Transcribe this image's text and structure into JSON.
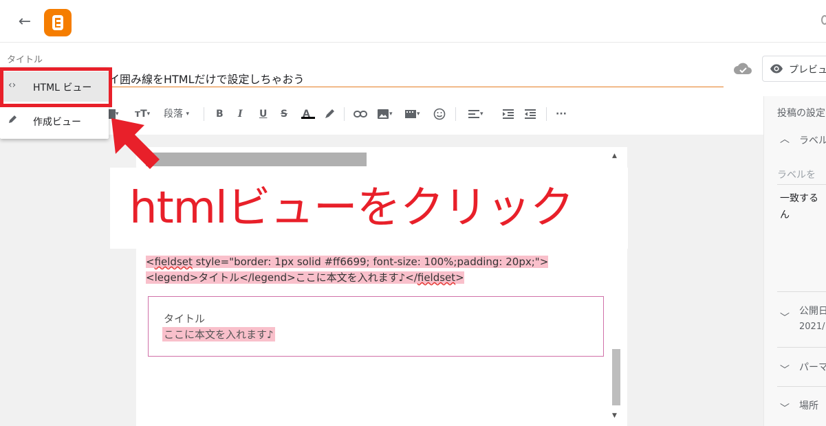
{
  "header": {
    "back_icon": "arrow-left-icon",
    "logo_icon": "blogger-logo-icon"
  },
  "title": {
    "label": "タイトル",
    "value": "イ囲み線をHTMLだけで設定しちゃおう"
  },
  "actions": {
    "preview_label": "プレビュー"
  },
  "view_menu": {
    "items": [
      {
        "icon": "code-icon",
        "label": "HTML ビュー",
        "active": true
      },
      {
        "icon": "pencil-icon",
        "label": "作成ビュー",
        "active": false
      }
    ]
  },
  "toolbar": {
    "paragraph_label": "段落",
    "bold": "B",
    "italic": "I",
    "underline": "U",
    "strike": "S",
    "font_color": "A",
    "more": "···"
  },
  "editor": {
    "code_line1_pre": "<",
    "code_line1_tag": "fieldset",
    "code_line1_post": " style=\"border: 1px solid #ff6699; font-size: 100%;padding: 20px;\">",
    "code_line2_pre": "<legend>タイトル</legend>ここに本文を入れます♪</",
    "code_line2_tag": "fieldset",
    "code_line2_post": ">",
    "fieldset_legend": "タイトル",
    "fieldset_body": "ここに本文を入れます♪"
  },
  "annotation": {
    "text": "htmlビューをクリック",
    "color": "#e8202a"
  },
  "side_panel": {
    "title": "投稿の設定",
    "labels_header": "ラベル",
    "labels_placeholder": "ラベルを",
    "labels_hint_1": "一致する",
    "labels_hint_2": "ん",
    "publish_header": "公開日",
    "publish_value": "2021/",
    "permalink_header": "パーマ",
    "location_header": "場所"
  },
  "colors": {
    "brand": "#f57d00",
    "title_underline": "#e67c22",
    "highlight": "#f9c0cb"
  }
}
